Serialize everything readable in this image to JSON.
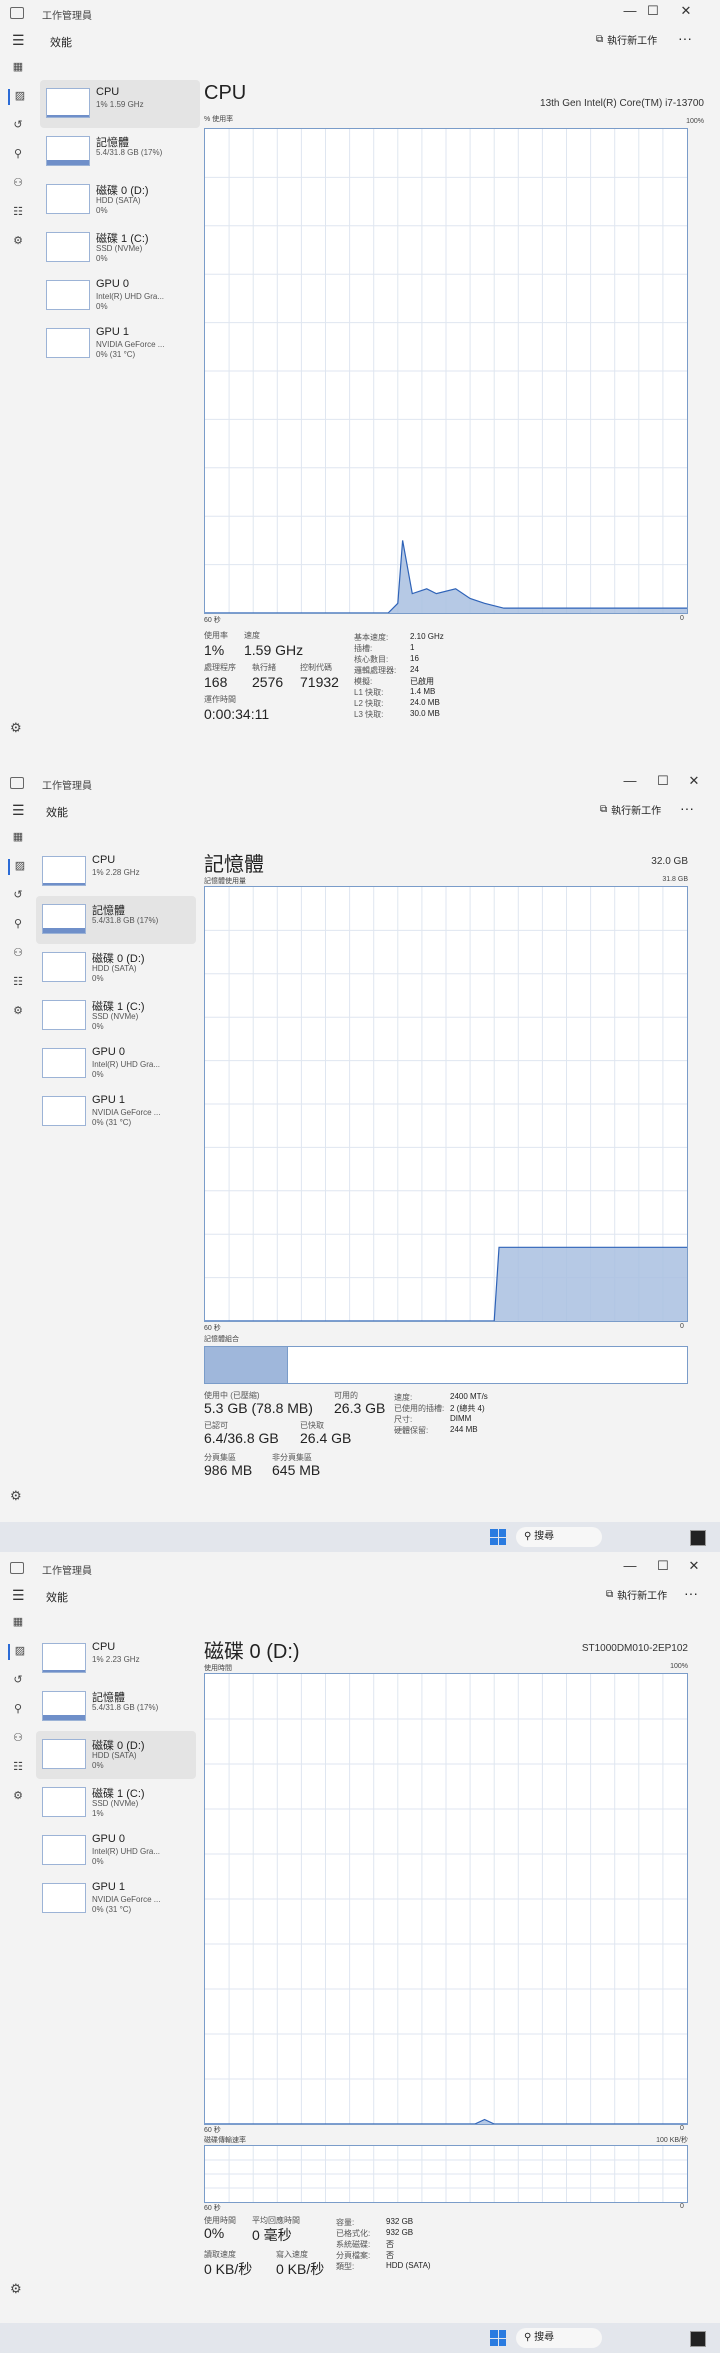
{
  "window": {
    "title": "工作管理員",
    "toolbar_title": "效能",
    "run_new_task": "執行新工作",
    "minimize": "—",
    "maximize": "☐",
    "close": "✕",
    "more": "···"
  },
  "sidebar": {
    "screen1": [
      {
        "name": "CPU",
        "sub1": "1% 1.59 GHz",
        "sub2": "",
        "fill": 0.05
      },
      {
        "name": "記憶體",
        "sub1": "5.4/31.8 GB (17%)",
        "sub2": "",
        "fill": 0.17
      },
      {
        "name": "磁碟 0 (D:)",
        "sub1": "HDD (SATA)",
        "sub2": "0%",
        "fill": 0
      },
      {
        "name": "磁碟 1 (C:)",
        "sub1": "SSD (NVMe)",
        "sub2": "0%",
        "fill": 0
      },
      {
        "name": "GPU 0",
        "sub1": "Intel(R) UHD Gra...",
        "sub2": "0%",
        "fill": 0
      },
      {
        "name": "GPU 1",
        "sub1": "NVIDIA GeForce ...",
        "sub2": "0% (31 °C)",
        "fill": 0
      }
    ],
    "screen2": [
      {
        "name": "CPU",
        "sub1": "1% 2.28 GHz",
        "sub2": "",
        "fill": 0.05
      },
      {
        "name": "記憶體",
        "sub1": "5.4/31.8 GB (17%)",
        "sub2": "",
        "fill": 0.17
      },
      {
        "name": "磁碟 0 (D:)",
        "sub1": "HDD (SATA)",
        "sub2": "0%",
        "fill": 0
      },
      {
        "name": "磁碟 1 (C:)",
        "sub1": "SSD (NVMe)",
        "sub2": "0%",
        "fill": 0
      },
      {
        "name": "GPU 0",
        "sub1": "Intel(R) UHD Gra...",
        "sub2": "0%",
        "fill": 0
      },
      {
        "name": "GPU 1",
        "sub1": "NVIDIA GeForce ...",
        "sub2": "0% (31 °C)",
        "fill": 0
      }
    ],
    "screen3": [
      {
        "name": "CPU",
        "sub1": "1% 2.23 GHz",
        "sub2": "",
        "fill": 0.05
      },
      {
        "name": "記憶體",
        "sub1": "5.4/31.8 GB (17%)",
        "sub2": "",
        "fill": 0.17
      },
      {
        "name": "磁碟 0 (D:)",
        "sub1": "HDD (SATA)",
        "sub2": "0%",
        "fill": 0
      },
      {
        "name": "磁碟 1 (C:)",
        "sub1": "SSD (NVMe)",
        "sub2": "1%",
        "fill": 0.01
      },
      {
        "name": "GPU 0",
        "sub1": "Intel(R) UHD Gra...",
        "sub2": "0%",
        "fill": 0
      },
      {
        "name": "GPU 1",
        "sub1": "NVIDIA GeForce ...",
        "sub2": "0% (31 °C)",
        "fill": 0
      }
    ]
  },
  "cpu": {
    "title": "CPU",
    "model": "13th Gen Intel(R) Core(TM) i7-13700",
    "graph_label": "% 使用率",
    "graph_max": "100%",
    "time_label": "60 秒",
    "zero": "0",
    "stats": {
      "util_label": "使用率",
      "util": "1%",
      "speed_label": "速度",
      "speed": "1.59 GHz",
      "proc_label": "處理程序",
      "proc": "168",
      "threads_label": "執行緒",
      "threads": "2576",
      "handles_label": "控制代碼",
      "handles": "71932",
      "uptime_label": "運作時間",
      "uptime": "0:00:34:11"
    },
    "details": [
      [
        "基本速度:",
        "2.10 GHz"
      ],
      [
        "插槽:",
        "1"
      ],
      [
        "核心數目:",
        "16"
      ],
      [
        "邏輯處理器:",
        "24"
      ],
      [
        "模擬:",
        "已啟用"
      ],
      [
        "L1 快取:",
        "1.4 MB"
      ],
      [
        "L2 快取:",
        "24.0 MB"
      ],
      [
        "L3 快取:",
        "30.0 MB"
      ]
    ]
  },
  "memory": {
    "title": "記憶體",
    "total": "32.0 GB",
    "graph_label": "記憶體使用量",
    "graph_max": "31.8 GB",
    "time_label": "60 秒",
    "zero": "0",
    "comp_label": "記憶體組合",
    "stats": {
      "inuse_label": "使用中 (已壓縮)",
      "inuse": "5.3 GB (78.8 MB)",
      "avail_label": "可用的",
      "avail": "26.3 GB",
      "commit_label": "已認可",
      "commit": "6.4/36.8 GB",
      "cached_label": "已快取",
      "cached": "26.4 GB",
      "paged_label": "分頁集區",
      "paged": "986 MB",
      "nonpaged_label": "非分頁集區",
      "nonpaged": "645 MB"
    },
    "details": [
      [
        "速度:",
        "2400 MT/s"
      ],
      [
        "已使用的插槽:",
        "2 (總共 4)"
      ],
      [
        "尺寸:",
        "DIMM"
      ],
      [
        "硬體保留:",
        "244 MB"
      ]
    ]
  },
  "disk": {
    "title": "磁碟 0 (D:)",
    "model": "ST1000DM010-2EP102",
    "graph_label": "使用時間",
    "graph_max": "100%",
    "time_label": "60 秒",
    "zero": "0",
    "rate_label": "磁碟傳輸速率",
    "rate_max": "100 KB/秒",
    "stats": {
      "active_label": "使用時間",
      "active": "0%",
      "resp_label": "平均回應時間",
      "resp": "0 毫秒",
      "read_label": "讀取速度",
      "read": "0 KB/秒",
      "write_label": "寫入速度",
      "write": "0 KB/秒"
    },
    "details": [
      [
        "容量:",
        "932 GB"
      ],
      [
        "已格式化:",
        "932 GB"
      ],
      [
        "系統磁碟:",
        "否"
      ],
      [
        "分頁檔案:",
        "否"
      ],
      [
        "類型:",
        "HDD (SATA)"
      ]
    ]
  },
  "taskbar": {
    "search": "搜尋"
  },
  "chart_data": [
    {
      "type": "area",
      "title": "CPU",
      "ylabel": "% 使用率",
      "ylim": [
        0,
        100
      ],
      "x": [
        0,
        38,
        40,
        41,
        43,
        46,
        48,
        52,
        55,
        58,
        62,
        70,
        80,
        90,
        100
      ],
      "values": [
        0,
        0,
        2,
        15,
        4,
        5,
        4,
        5,
        3,
        2,
        1,
        1,
        1,
        1,
        1
      ]
    },
    {
      "type": "area",
      "title": "記憶體",
      "ylabel": "記憶體使用量",
      "ylim": [
        0,
        31.8
      ],
      "x": [
        0,
        60,
        61,
        100
      ],
      "values": [
        0,
        0,
        5.4,
        5.4
      ]
    },
    {
      "type": "area",
      "title": "磁碟 0 (D:)",
      "ylabel": "使用時間",
      "ylim": [
        0,
        100
      ],
      "x": [
        0,
        56,
        58,
        60,
        100
      ],
      "values": [
        0,
        0,
        1,
        0,
        0
      ]
    }
  ]
}
